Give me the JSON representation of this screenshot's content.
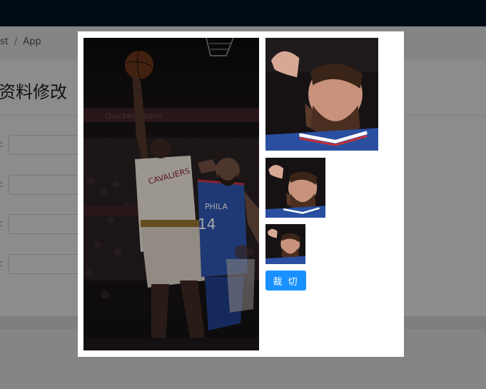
{
  "breadcrumb": {
    "prev": "st",
    "current": "App"
  },
  "page": {
    "title": "资料修改"
  },
  "form": {
    "colon": ":"
  },
  "modal": {
    "crop_button_label": "裁 切",
    "arena_banner_text": "Quicken Loans",
    "jersey_left": "CAVALIERS",
    "jersey_right_team": "PHILA",
    "jersey_right_number": "14"
  },
  "colors": {
    "primary": "#1890ff",
    "header": "#001529",
    "mask": "rgba(0,0,0,0.45)"
  },
  "icons": {
    "photo_subject": "basketball-player-photo"
  }
}
